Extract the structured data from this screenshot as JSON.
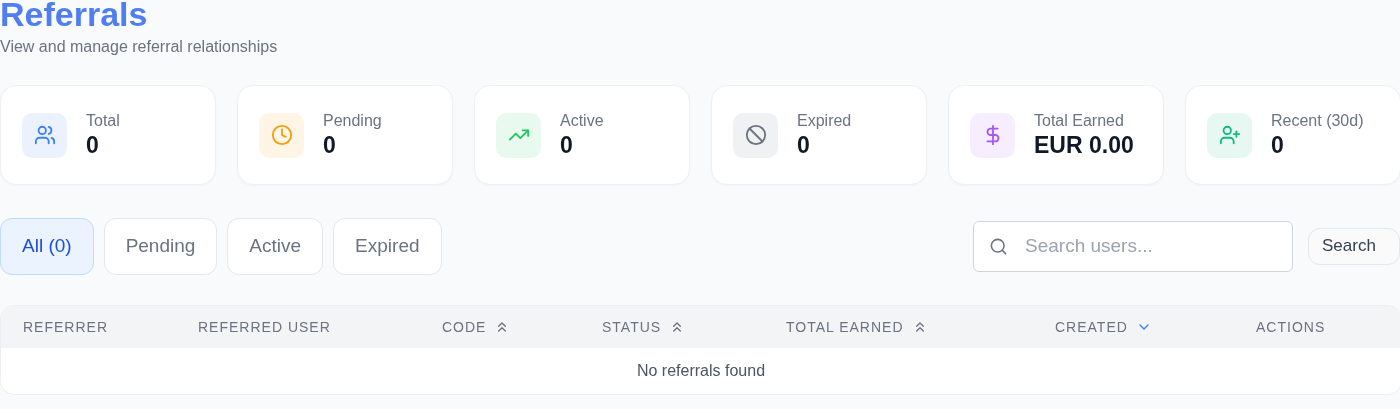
{
  "header": {
    "title": "Referrals",
    "subtitle": "View and manage referral relationships"
  },
  "stats": [
    {
      "kind": "users",
      "label": "Total",
      "value": "0",
      "color": "#3b82f6"
    },
    {
      "kind": "clock",
      "label": "Pending",
      "value": "0",
      "color": "#f59e0b"
    },
    {
      "kind": "trend",
      "label": "Active",
      "value": "0",
      "color": "#22c55e"
    },
    {
      "kind": "ban",
      "label": "Expired",
      "value": "0",
      "color": "#6b7280"
    },
    {
      "kind": "dollar",
      "label": "Total Earned",
      "value": "EUR 0.00",
      "color": "#a855f7"
    },
    {
      "kind": "userplus",
      "label": "Recent (30d)",
      "value": "0",
      "color": "#10b981"
    }
  ],
  "filters": [
    {
      "label": "All (0)",
      "selected": true
    },
    {
      "label": "Pending",
      "selected": false
    },
    {
      "label": "Active",
      "selected": false
    },
    {
      "label": "Expired",
      "selected": false
    }
  ],
  "search": {
    "placeholder": "Search users...",
    "button": "Search"
  },
  "table": {
    "columns": [
      {
        "label": "REFERRER"
      },
      {
        "label": "REFERRED USER"
      },
      {
        "label": "CODE",
        "sorted": false
      },
      {
        "label": "STATUS",
        "sorted": false
      },
      {
        "label": "TOTAL EARNED",
        "sorted": false
      },
      {
        "label": "CREATED",
        "sorted": true
      },
      {
        "label": "ACTIONS"
      }
    ],
    "empty": "No referrals found"
  }
}
